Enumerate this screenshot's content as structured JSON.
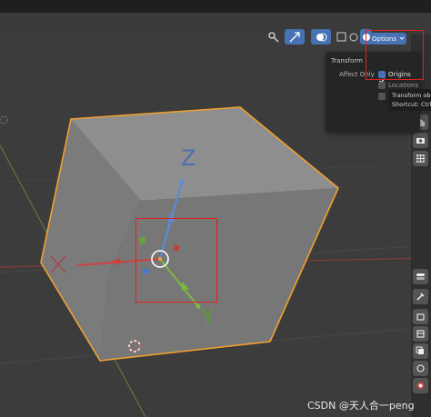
{
  "header": {
    "icons": [
      "object-origin-icon",
      "gizmo-icon",
      "overlay-icon",
      "xray-icon",
      "wireframe-shading-icon",
      "solid-shading-icon",
      "material-shading-icon",
      "rendered-shading-icon",
      "shading-options-icon"
    ]
  },
  "options_button": {
    "label": "Options"
  },
  "popup": {
    "title": "Transform",
    "affect_only_label": "Affect Only",
    "items": [
      {
        "label": "Origins",
        "checked": true
      },
      {
        "label": "Locations",
        "checked": false
      },
      {
        "label": "",
        "checked": false
      }
    ]
  },
  "tooltip": {
    "line1": "Transform ob",
    "line2": "Shortcut: Ctrl"
  },
  "gizmo": {
    "z_label": "Z",
    "y_label": "Y"
  },
  "right_toolbar": {
    "icons": [
      "hand-pan-icon",
      "camera-icon",
      "grid-icon",
      "properties-toggle-icon",
      "tool-icon",
      "render-icon",
      "output-icon",
      "view-layer-icon",
      "scene-icon",
      "world-icon"
    ]
  },
  "watermark": "CSDN @天人合一peng",
  "colors": {
    "accent": "#4772b3",
    "highlight_box": "#e02020",
    "selection_outline": "#f0a030"
  }
}
